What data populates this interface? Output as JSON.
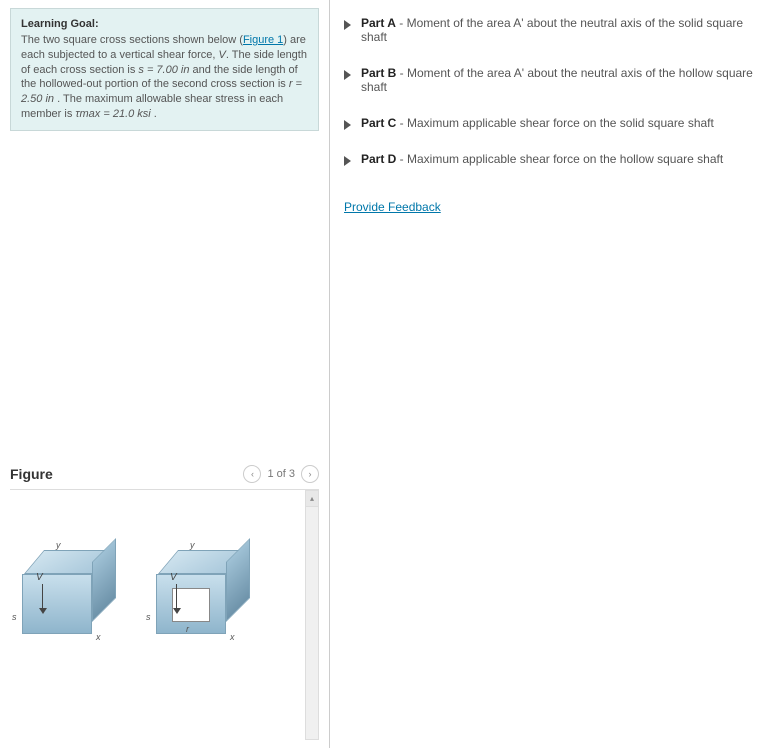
{
  "goal": {
    "heading": "Learning Goal:",
    "line1a": "The two square cross sections shown below (",
    "figure_link": "Figure 1",
    "line1b": ") are each subjected to a vertical shear force, ",
    "V": "V",
    "line1c": ". The side length of each cross section is ",
    "s_eq": "s = 7.00 in",
    "line1d": " and the side length of the hollowed-out portion of the second cross section is ",
    "r_eq": "r = 2.50 in",
    "line1e": " . The maximum allowable shear stress in each member is ",
    "tau_eq": "τmax = 21.0 ksi",
    "line1f": " ."
  },
  "figure": {
    "title": "Figure",
    "pager_text": "1 of 3",
    "prev": "‹",
    "next": "›",
    "y": "y",
    "x": "x",
    "s": "s",
    "r": "r",
    "V": "V",
    "up": "▴"
  },
  "parts": [
    {
      "label": "Part A",
      "desc": " - Moment of the area A' about the neutral axis of the solid square shaft"
    },
    {
      "label": "Part B",
      "desc": " - Moment of the area A' about the neutral axis of the hollow square shaft"
    },
    {
      "label": "Part C",
      "desc": " - Maximum applicable shear force on the solid square shaft"
    },
    {
      "label": "Part D",
      "desc": " - Maximum applicable shear force on the hollow square shaft"
    }
  ],
  "feedback": "Provide Feedback"
}
